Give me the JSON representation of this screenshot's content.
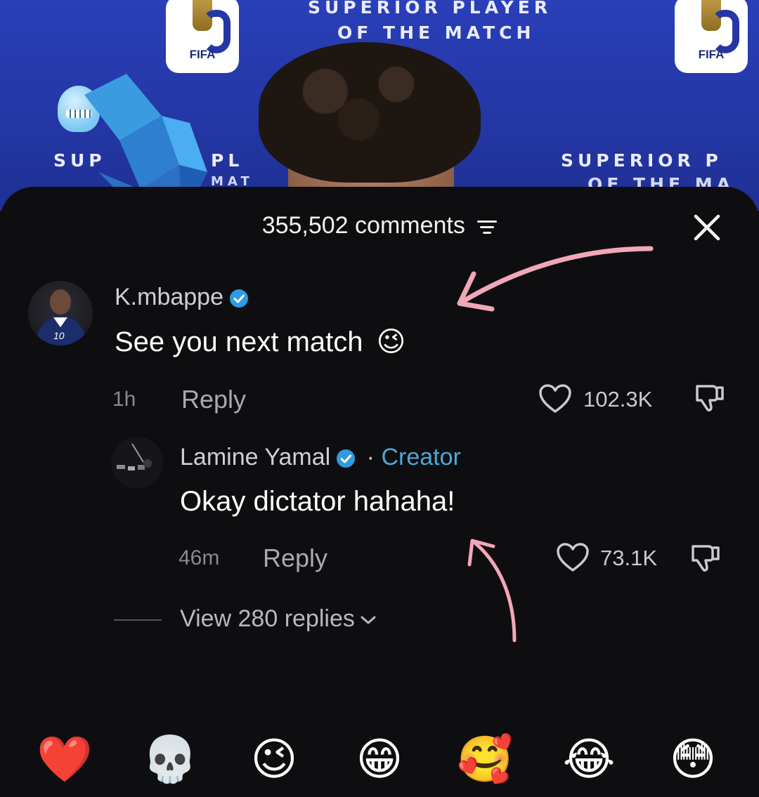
{
  "background": {
    "banner_line1": "SUPERIOR PLAYER",
    "banner_line2": "OF THE MATCH",
    "banner_right": "SUPERIOR P",
    "banner_right2": "OF THE MA",
    "banner_left": "SUP",
    "banner_mid": "PL",
    "banner_mid2": "MAT",
    "fifa_label": "FIFA"
  },
  "header": {
    "comment_count": "355,502 comments",
    "filter_icon": "filter-icon",
    "close_icon": "close-icon"
  },
  "comments": [
    {
      "author": "K.mbappe",
      "verified": true,
      "text": "See you next match",
      "emoji": "😉",
      "time": "1h",
      "reply_label": "Reply",
      "likes": "102.3K",
      "avatar_badge": "10"
    },
    {
      "author": "Lamine Yamal",
      "verified": true,
      "separator": "·",
      "role": "Creator",
      "text": "Okay dictator hahaha!",
      "time": "46m",
      "reply_label": "Reply",
      "likes": "73.1K"
    }
  ],
  "view_replies": "View 280 replies",
  "emoji_bar": [
    "❤️",
    "💀",
    "😉",
    "😁",
    "🥰",
    "😂",
    "😳"
  ],
  "colors": {
    "sheet_bg": "#0e0e10",
    "verified": "#2f9be0",
    "creator": "#4ea6d6",
    "annotation_arrow": "#f2a7b8"
  }
}
